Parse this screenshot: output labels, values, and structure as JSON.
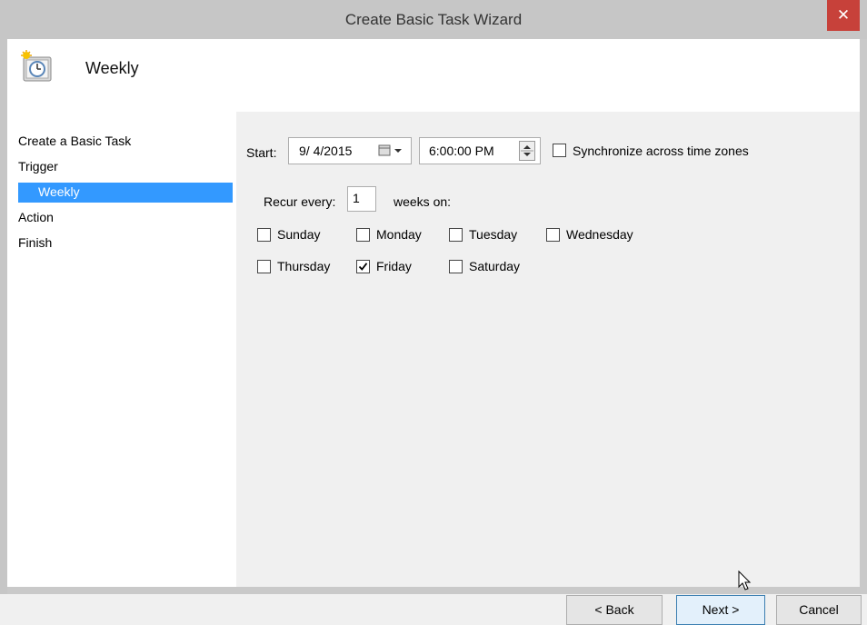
{
  "window": {
    "title": "Create Basic Task Wizard",
    "close_glyph": "✕"
  },
  "header": {
    "title": "Weekly",
    "icon": "task-scheduler-clock-icon"
  },
  "steps": [
    {
      "label": "Create a Basic Task"
    },
    {
      "label": "Trigger"
    },
    {
      "label": "Weekly"
    },
    {
      "label": "Action"
    },
    {
      "label": "Finish"
    }
  ],
  "start": {
    "label": "Start:",
    "date": "9/ 4/2015",
    "time": "6:00:00 PM",
    "sync_label": "Synchronize across time zones",
    "sync_checked": false
  },
  "recur": {
    "label": "Recur every:",
    "value": "1",
    "suffix": "weeks on:"
  },
  "days": [
    {
      "label": "Sunday",
      "checked": false
    },
    {
      "label": "Monday",
      "checked": false
    },
    {
      "label": "Tuesday",
      "checked": false
    },
    {
      "label": "Wednesday",
      "checked": false
    },
    {
      "label": "Thursday",
      "checked": false
    },
    {
      "label": "Friday",
      "checked": true
    },
    {
      "label": "Saturday",
      "checked": false
    }
  ],
  "buttons": {
    "back": "< Back",
    "next": "Next >",
    "cancel": "Cancel"
  },
  "colors": {
    "selection": "#3399ff",
    "close": "#c7413a"
  }
}
